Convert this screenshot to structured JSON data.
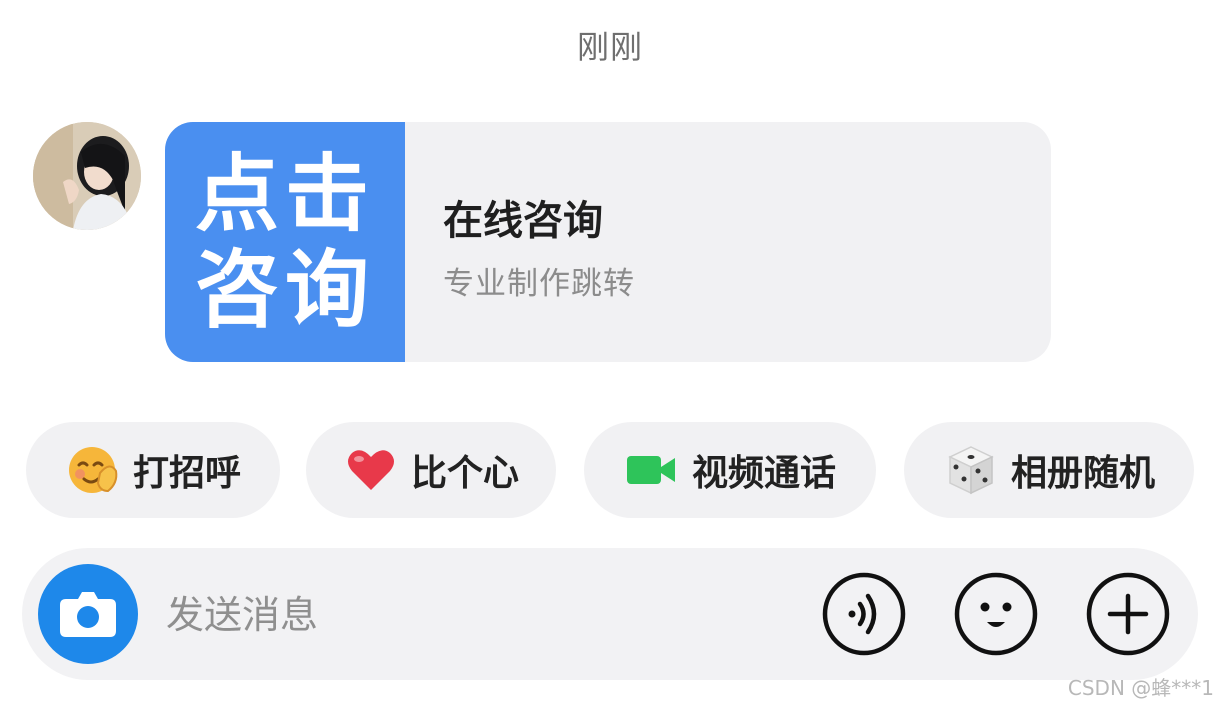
{
  "timestamp": "刚刚",
  "card": {
    "thumb_line1": "点击",
    "thumb_line2": "咨询",
    "title": "在线咨询",
    "subtitle": "专业制作跳转"
  },
  "quick_actions": [
    {
      "label": "打招呼",
      "icon": "waving-face-icon"
    },
    {
      "label": "比个心",
      "icon": "heart-icon"
    },
    {
      "label": "视频通话",
      "icon": "video-camera-icon"
    },
    {
      "label": "相册随机",
      "icon": "dice-icon"
    }
  ],
  "input": {
    "placeholder": "发送消息"
  },
  "watermark": "CSDN @蜂***1",
  "colors": {
    "accent_blue": "#1e88ea",
    "card_thumb_blue": "#4a8ff0",
    "chip_background": "#f1f1f3",
    "heart_red": "#e8394a",
    "video_green": "#2ec45a"
  }
}
